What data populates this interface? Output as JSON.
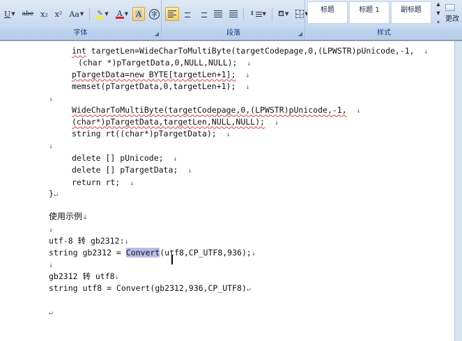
{
  "ribbon": {
    "font_group": {
      "label": "字体",
      "buttons": [
        "U",
        "abe",
        "x₂",
        "x²",
        "Aa",
        "A",
        "A",
        "A",
        "字"
      ]
    },
    "paragraph_group": {
      "label": "段落"
    },
    "styles_group": {
      "label": "样式",
      "styles": [
        "标题",
        "标题 1",
        "副标题"
      ],
      "more": "更改"
    }
  },
  "doc": {
    "lines": [
      {
        "text": "int targetLen=WideCharToMultiByte(targetCodepage,0,(LPWSTR)pUnicode,-1,",
        "mark": "↓"
      },
      {
        "text": "(char *)pTargetData,0,NULL,NULL);",
        "mark": "↓"
      },
      {
        "text": "pTargetData=new BYTE[targetLen+1];",
        "mark": "↓"
      },
      {
        "text": "memset(pTargetData,0,targetLen+1);",
        "mark": "↓"
      },
      {
        "text": "",
        "mark": "↓"
      },
      {
        "text": "WideCharToMultiByte(targetCodepage,0,(LPWSTR)pUnicode,-1,",
        "mark": "↓"
      },
      {
        "text": "(char*)pTargetData,targetLen,NULL,NULL);",
        "mark": "↓"
      },
      {
        "text": "string rt((char*)pTargetData);",
        "mark": "↓"
      },
      {
        "text": "",
        "mark": "↓"
      },
      {
        "text": "delete [] pUnicode;",
        "mark": "↓"
      },
      {
        "text": "delete [] pTargetData;",
        "mark": "↓"
      },
      {
        "text": "return rt;",
        "mark": "↓"
      },
      {
        "text": "}",
        "mark": "↵"
      },
      {
        "text": "使用示例",
        "mark": "↓"
      },
      {
        "text": "",
        "mark": "↓"
      },
      {
        "text": "utf-8 转 gb2312:",
        "mark": "↓"
      },
      {
        "text_before": "string gb2312 = ",
        "highlight": "Convert",
        "text_after": "(utf8,CP_UTF8,936);",
        "mark": "↓"
      },
      {
        "text": "",
        "mark": "↓"
      },
      {
        "text": "gb2312 转 utf8",
        "mark": "↓"
      },
      {
        "text": "string utf8 = Convert(gb2312,936,CP_UTF8)",
        "mark": "↵"
      },
      {
        "text": "",
        "mark": "↵"
      }
    ]
  }
}
